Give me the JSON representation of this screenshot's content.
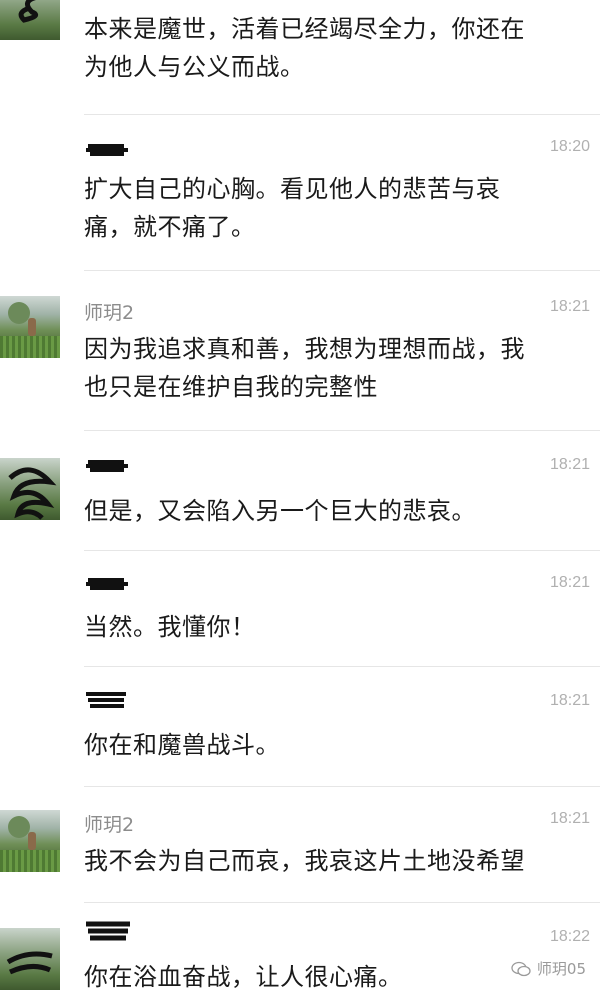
{
  "messages": [
    {
      "sender": "",
      "time": "",
      "text_lines": [
        "本来是魔世，活着已经竭尽全力，你还在",
        "为他人与公义而战。"
      ]
    },
    {
      "sender": "",
      "time": "18:20",
      "text_lines": [
        "扩大自己的心胸。看见他人的悲苦与哀",
        "痛，就不痛了。"
      ]
    },
    {
      "sender": "师玥2",
      "time": "18:21",
      "text_lines": [
        "因为我追求真和善，我想为理想而战，我",
        "也只是在维护自我的完整性"
      ]
    },
    {
      "sender": "",
      "time": "18:21",
      "text_lines": [
        "但是，又会陷入另一个巨大的悲哀。"
      ]
    },
    {
      "sender": "",
      "time": "18:21",
      "text_lines": [
        "当然。我懂你！"
      ]
    },
    {
      "sender": "",
      "time": "18:21",
      "text_lines": [
        "你在和魔兽战斗。"
      ]
    },
    {
      "sender": "师玥2",
      "time": "18:21",
      "text_lines": [
        "我不会为自己而哀，我哀这片土地没希望"
      ]
    },
    {
      "sender": "",
      "time": "18:22",
      "text_lines": [
        "你在浴血奋战，让人很心痛。"
      ]
    }
  ],
  "watermark": {
    "icon": "wechat-icon",
    "label": "师玥05"
  }
}
